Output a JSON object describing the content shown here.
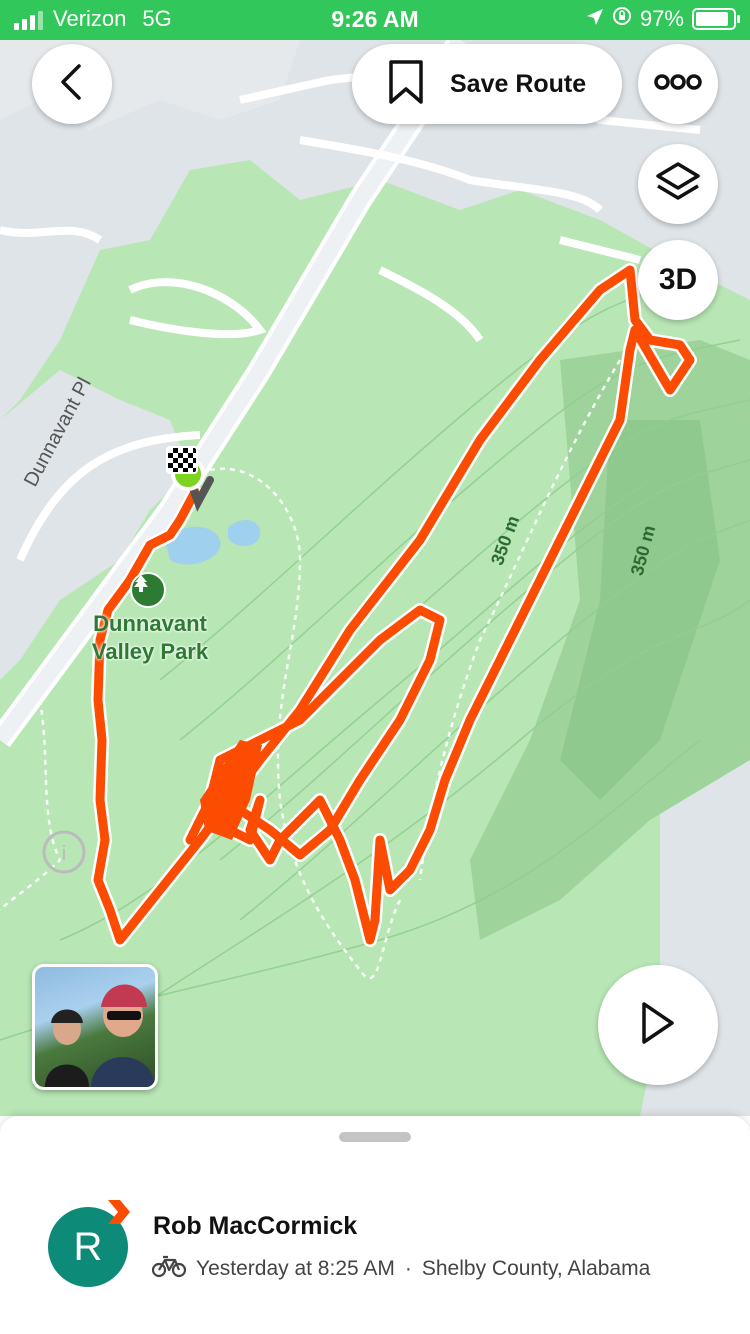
{
  "status_bar": {
    "carrier": "Verizon",
    "network": "5G",
    "time": "9:26 AM",
    "battery": "97%"
  },
  "toolbar": {
    "save_route_label": "Save Route",
    "three_d_label": "3D"
  },
  "map": {
    "road_label": "Dunnavant Pl",
    "park_label": "Dunnavant Valley Park",
    "elevation_labels": [
      "350 m",
      "350 m"
    ]
  },
  "activity": {
    "owner_initial": "R",
    "owner_name": "Rob MacCormick",
    "when": "Yesterday at 8:25 AM",
    "separator": "·",
    "location": "Shelby County, Alabama",
    "sport_icon": "bike-icon"
  },
  "colors": {
    "status_bar": "#32c75a",
    "route": "#fc4c02",
    "map_green": "#b8e6b5",
    "avatar": "#0e8a78"
  }
}
